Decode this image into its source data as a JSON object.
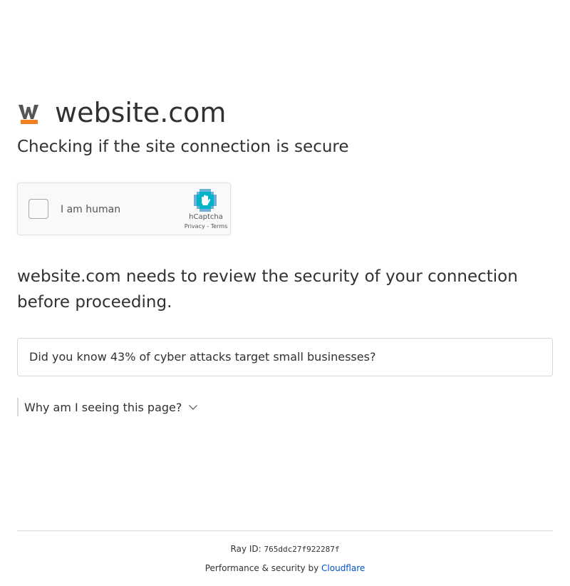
{
  "header": {
    "favicon_icon": "w-logo-icon",
    "site_name": "website.com",
    "subtitle": "Checking if the site connection is secure"
  },
  "captcha": {
    "label": "I am human",
    "brand": "hCaptcha",
    "privacy_link": "Privacy",
    "separator": " - ",
    "terms_link": "Terms",
    "logo_icon": "hcaptcha-logo-icon"
  },
  "main": {
    "review_message": "website.com needs to review the security of your connection before proceeding.",
    "tip": "Did you know 43% of cyber attacks target small businesses?",
    "why_label": "Why am I seeing this page?",
    "why_icon": "chevron-down-icon"
  },
  "footer": {
    "ray_label": "Ray ID:",
    "ray_id": "765ddc27f922287f",
    "perf_text": "Performance & security by",
    "provider_link": "Cloudflare"
  },
  "colors": {
    "text": "#313131",
    "link": "#0051c3",
    "favicon_orange": "#f38020",
    "hcaptcha_blue": "#0074bf",
    "hcaptcha_teal": "#00b3c5"
  }
}
